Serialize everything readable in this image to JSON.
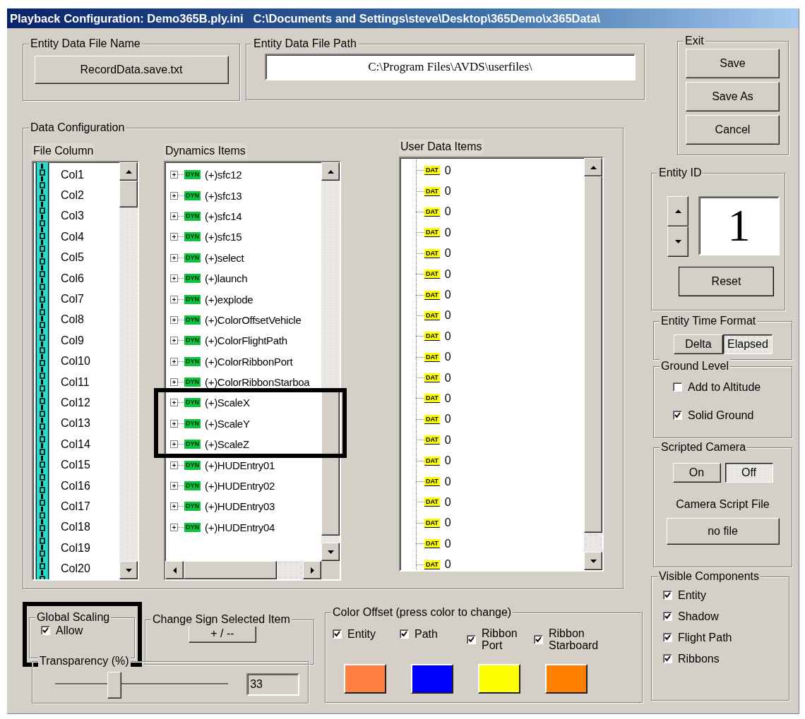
{
  "window": {
    "title": "Playback Configuration: Demo365B.ply.ini   C:\\Documents and Settings\\steve\\Desktop\\365Demo\\x365Data\\"
  },
  "entity_data_file_name": {
    "label": "Entity Data File Name",
    "button": "RecordData.save.txt"
  },
  "entity_data_file_path": {
    "label": "Entity Data File Path",
    "value": "C:\\Program Files\\AVDS\\userfiles\\"
  },
  "exit": {
    "label": "Exit",
    "buttons": [
      "Save",
      "Save As",
      "Cancel"
    ]
  },
  "data_configuration": {
    "label": "Data Configuration",
    "file_column": {
      "header": "File Column",
      "items": [
        "Col1",
        "Col2",
        "Col3",
        "Col4",
        "Col5",
        "Col6",
        "Col7",
        "Col8",
        "Col9",
        "Col10",
        "Col11",
        "Col12",
        "Col13",
        "Col14",
        "Col15",
        "Col16",
        "Col17",
        "Col18",
        "Col19",
        "Col20"
      ]
    },
    "dynamics_items": {
      "header": "Dynamics Items",
      "items": [
        {
          "badge": "DYN",
          "label": "(+)sfc12",
          "expanded": false,
          "callout": false
        },
        {
          "badge": "DYN",
          "label": "(+)sfc13",
          "expanded": false,
          "callout": false
        },
        {
          "badge": "DYN",
          "label": "(+)sfc14",
          "expanded": false,
          "callout": false
        },
        {
          "badge": "DYN",
          "label": "(+)sfc15",
          "expanded": false,
          "callout": false
        },
        {
          "badge": "DYN",
          "label": "(+)select",
          "expanded": false,
          "callout": false
        },
        {
          "badge": "DYN",
          "label": "(+)launch",
          "expanded": false,
          "callout": false
        },
        {
          "badge": "DYN",
          "label": "(+)explode",
          "expanded": false,
          "callout": false
        },
        {
          "badge": "DYN",
          "label": "(+)ColorOffsetVehicle",
          "expanded": false,
          "callout": false
        },
        {
          "badge": "DYN",
          "label": "(+)ColorFlightPath",
          "expanded": false,
          "callout": false
        },
        {
          "badge": "DYN",
          "label": "(+)ColorRibbonPort",
          "expanded": false,
          "callout": false
        },
        {
          "badge": "DYN",
          "label": "(+)ColorRibbonStarboa",
          "expanded": false,
          "callout": false
        },
        {
          "badge": "DYN",
          "label": "(+)ScaleX",
          "expanded": false,
          "callout": true
        },
        {
          "badge": "DYN",
          "label": "(+)ScaleY",
          "expanded": false,
          "callout": true
        },
        {
          "badge": "DYN",
          "label": "(+)ScaleZ",
          "expanded": false,
          "callout": true
        },
        {
          "badge": "DYN",
          "label": "(+)HUDEntry01",
          "expanded": false,
          "callout": false
        },
        {
          "badge": "DYN",
          "label": "(+)HUDEntry02",
          "expanded": false,
          "callout": false
        },
        {
          "badge": "DYN",
          "label": "(+)HUDEntry03",
          "expanded": false,
          "callout": false
        },
        {
          "badge": "DYN",
          "label": "(+)HUDEntry04",
          "expanded": false,
          "callout": false
        }
      ]
    },
    "user_data_items": {
      "header": "User Data Items",
      "items": [
        {
          "badge": "DAT",
          "label": "0"
        },
        {
          "badge": "DAT",
          "label": "0"
        },
        {
          "badge": "DAT",
          "label": "0"
        },
        {
          "badge": "DAT",
          "label": "0"
        },
        {
          "badge": "DAT",
          "label": "0"
        },
        {
          "badge": "DAT",
          "label": "0"
        },
        {
          "badge": "DAT",
          "label": "0"
        },
        {
          "badge": "DAT",
          "label": "0"
        },
        {
          "badge": "DAT",
          "label": "0"
        },
        {
          "badge": "DAT",
          "label": "0"
        },
        {
          "badge": "DAT",
          "label": "0"
        },
        {
          "badge": "DAT",
          "label": "0"
        },
        {
          "badge": "DAT",
          "label": "0"
        },
        {
          "badge": "DAT",
          "label": "0"
        },
        {
          "badge": "DAT",
          "label": "0"
        },
        {
          "badge": "DAT",
          "label": "0"
        },
        {
          "badge": "DAT",
          "label": "0"
        },
        {
          "badge": "DAT",
          "label": "0"
        },
        {
          "badge": "DAT",
          "label": "0"
        },
        {
          "badge": "DAT",
          "label": "0"
        }
      ]
    }
  },
  "global_scaling": {
    "label": "Global Scaling",
    "callout": true,
    "checkbox": {
      "label": "Allow",
      "checked": true
    }
  },
  "change_sign": {
    "label": "Change Sign Selected Item",
    "button": "+ / --"
  },
  "transparency": {
    "label": "Transparency (%)",
    "level": 0.33,
    "value": "33"
  },
  "color_offset": {
    "label": "Color Offset (press color to change)",
    "items": [
      {
        "label": "Entity",
        "checked": true,
        "color": "#ff8040"
      },
      {
        "label": "Path",
        "checked": true,
        "color": "#0000ff"
      },
      {
        "label": "Ribbon Port",
        "checked": true,
        "color": "#ffff00"
      },
      {
        "label": "Ribbon Starboard",
        "checked": true,
        "color": "#ff8000"
      }
    ]
  },
  "entity_id": {
    "label": "Entity ID",
    "value": "1",
    "reset_button": "Reset"
  },
  "entity_time_format": {
    "label": "Entity Time Format",
    "options": [
      {
        "label": "Delta",
        "selected": false
      },
      {
        "label": "Elapsed",
        "selected": true
      }
    ]
  },
  "ground_level": {
    "label": "Ground Level",
    "items": [
      {
        "label": "Add to Altitude",
        "checked": false
      },
      {
        "label": "Solid Ground",
        "checked": true
      }
    ]
  },
  "scripted_camera": {
    "label": "Scripted Camera",
    "options": [
      {
        "label": "On",
        "selected": false
      },
      {
        "label": "Off",
        "selected": true
      }
    ],
    "script_file_label": "Camera Script File",
    "script_file_button": "no file"
  },
  "visible_components": {
    "label": "Visible Components",
    "items": [
      {
        "label": "Entity",
        "checked": true
      },
      {
        "label": "Shadow",
        "checked": true
      },
      {
        "label": "Flight Path",
        "checked": true
      },
      {
        "label": "Ribbons",
        "checked": true
      }
    ]
  }
}
